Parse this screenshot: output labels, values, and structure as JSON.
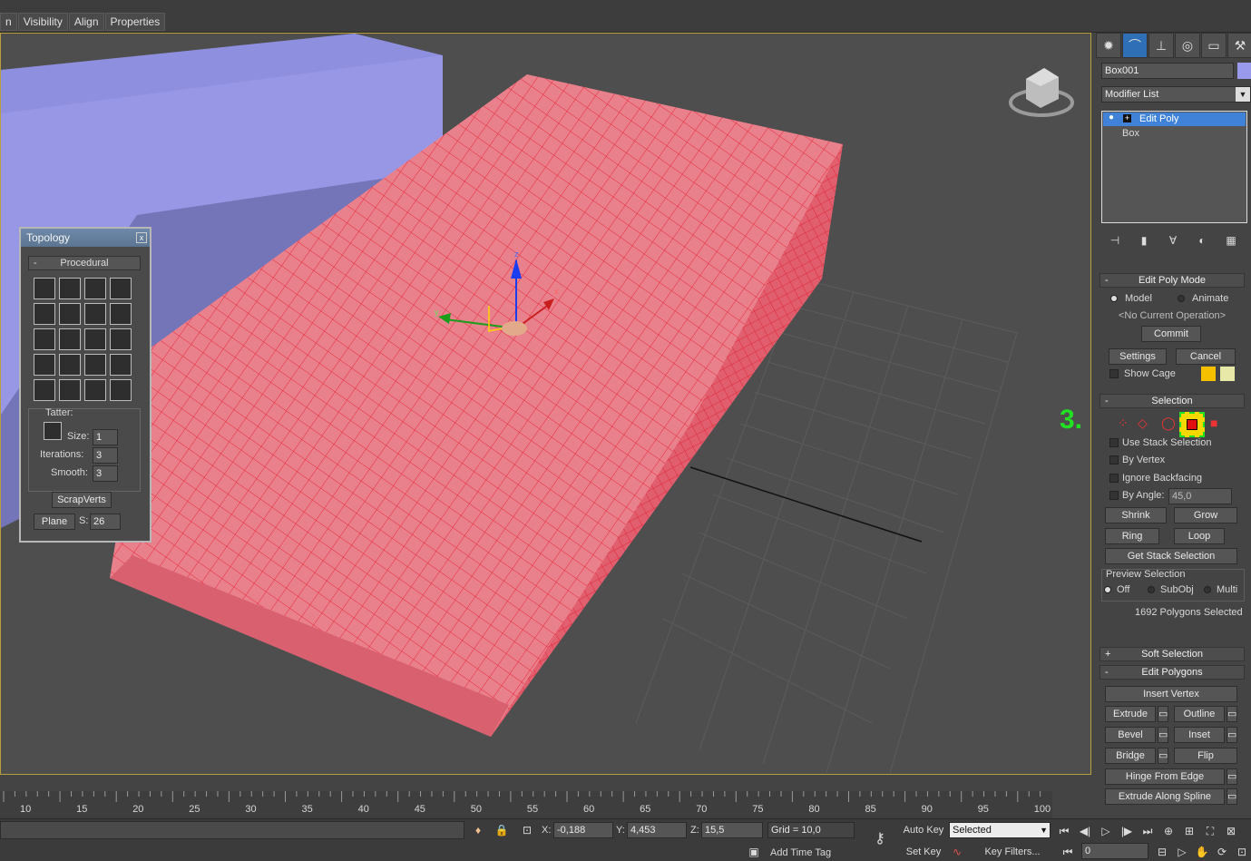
{
  "menubar": {
    "items": [
      "n",
      "Visibility",
      "Align",
      "Properties"
    ]
  },
  "viewport": {
    "gizmo_labels": {
      "z": "z",
      "x": "x",
      "y": "y"
    },
    "annotation": "3."
  },
  "topology": {
    "title": "Topology",
    "close_label": "x",
    "section_sign": "-",
    "section": "Procedural",
    "tatter_label": "Tatter:",
    "size_label": "Size:",
    "size_value": "1",
    "iterations_label": "Iterations:",
    "iterations_value": "3",
    "smooth_label": "Smooth:",
    "smooth_value": "3",
    "scrapverts_label": "ScrapVerts",
    "plane_label": "Plane",
    "s_label": "S:",
    "s_value": "26"
  },
  "command_panel": {
    "tabs": [
      "create-icon",
      "modify-icon",
      "hierarchy-icon",
      "motion-icon",
      "display-icon",
      "utilities-icon"
    ],
    "object_name": "Box001",
    "object_color": "#9a9aec",
    "modifier_list": "Modifier List",
    "stack": [
      "Edit Poly",
      "Box"
    ],
    "edit_poly_mode": {
      "title": "Edit Poly Mode",
      "model": "Model",
      "animate": "Animate",
      "operation": "<No Current Operation>",
      "commit": "Commit",
      "settings": "Settings",
      "cancel": "Cancel",
      "show_cage": "Show Cage",
      "cage_colors": [
        "#f5c000",
        "#e8e8a8"
      ]
    },
    "selection": {
      "title": "Selection",
      "use_stack": "Use Stack Selection",
      "by_vertex": "By Vertex",
      "ignore_backfacing": "Ignore Backfacing",
      "by_angle": "By Angle:",
      "angle_value": "45,0",
      "shrink": "Shrink",
      "grow": "Grow",
      "ring": "Ring",
      "loop": "Loop",
      "get_stack": "Get Stack Selection",
      "preview_title": "Preview Selection",
      "off": "Off",
      "subobj": "SubObj",
      "multi": "Multi",
      "count_text": "1692 Polygons Selected"
    },
    "soft_selection": {
      "sign": "+",
      "title": "Soft Selection"
    },
    "edit_polygons": {
      "sign": "-",
      "title": "Edit Polygons",
      "insert_vertex": "Insert Vertex",
      "extrude": "Extrude",
      "outline": "Outline",
      "bevel": "Bevel",
      "inset": "Inset",
      "bridge": "Bridge",
      "flip": "Flip",
      "hinge": "Hinge From Edge",
      "extrude_spline": "Extrude Along Spline"
    },
    "section_sign": "-"
  },
  "timeline": {
    "ticks": [
      "10",
      "15",
      "20",
      "25",
      "30",
      "35",
      "40",
      "45",
      "50",
      "55",
      "60",
      "65",
      "70",
      "75",
      "80",
      "85",
      "90",
      "95",
      "100"
    ]
  },
  "statusbar": {
    "x_label": "X:",
    "x_value": "-0,188",
    "y_label": "Y:",
    "y_value": "4,453",
    "z_label": "Z:",
    "z_value": "15,5",
    "grid": "Grid = 10,0",
    "add_time_tag": "Add Time Tag",
    "auto_key": "Auto Key",
    "selected": "Selected",
    "set_key": "Set Key",
    "key_filters": "Key Filters...",
    "frame_value": "0"
  }
}
